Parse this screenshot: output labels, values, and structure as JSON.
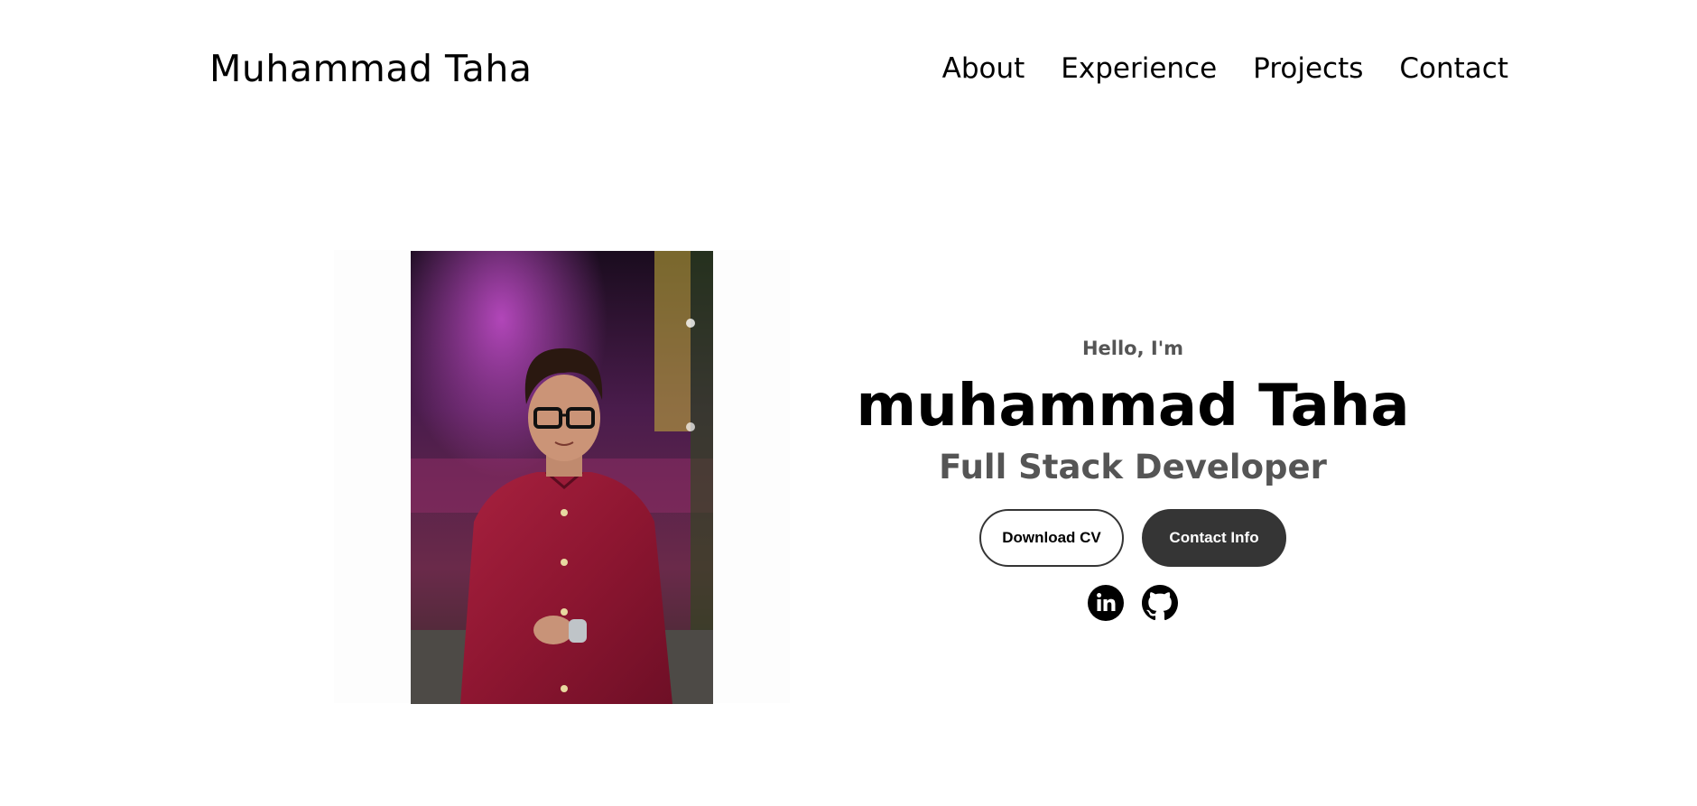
{
  "header": {
    "logo": "Muhammad Taha",
    "nav": [
      "About",
      "Experience",
      "Projects",
      "Contact"
    ]
  },
  "hero": {
    "greeting": "Hello, I'm",
    "name": "muhammad Taha",
    "role": "Full Stack Developer",
    "buttons": {
      "download": "Download CV",
      "contact": "Contact Info"
    },
    "socials": [
      "linkedin-icon",
      "github-icon"
    ]
  },
  "colors": {
    "text": "#000000",
    "muted": "#555555",
    "button_dark": "#353535",
    "background": "#ffffff"
  }
}
